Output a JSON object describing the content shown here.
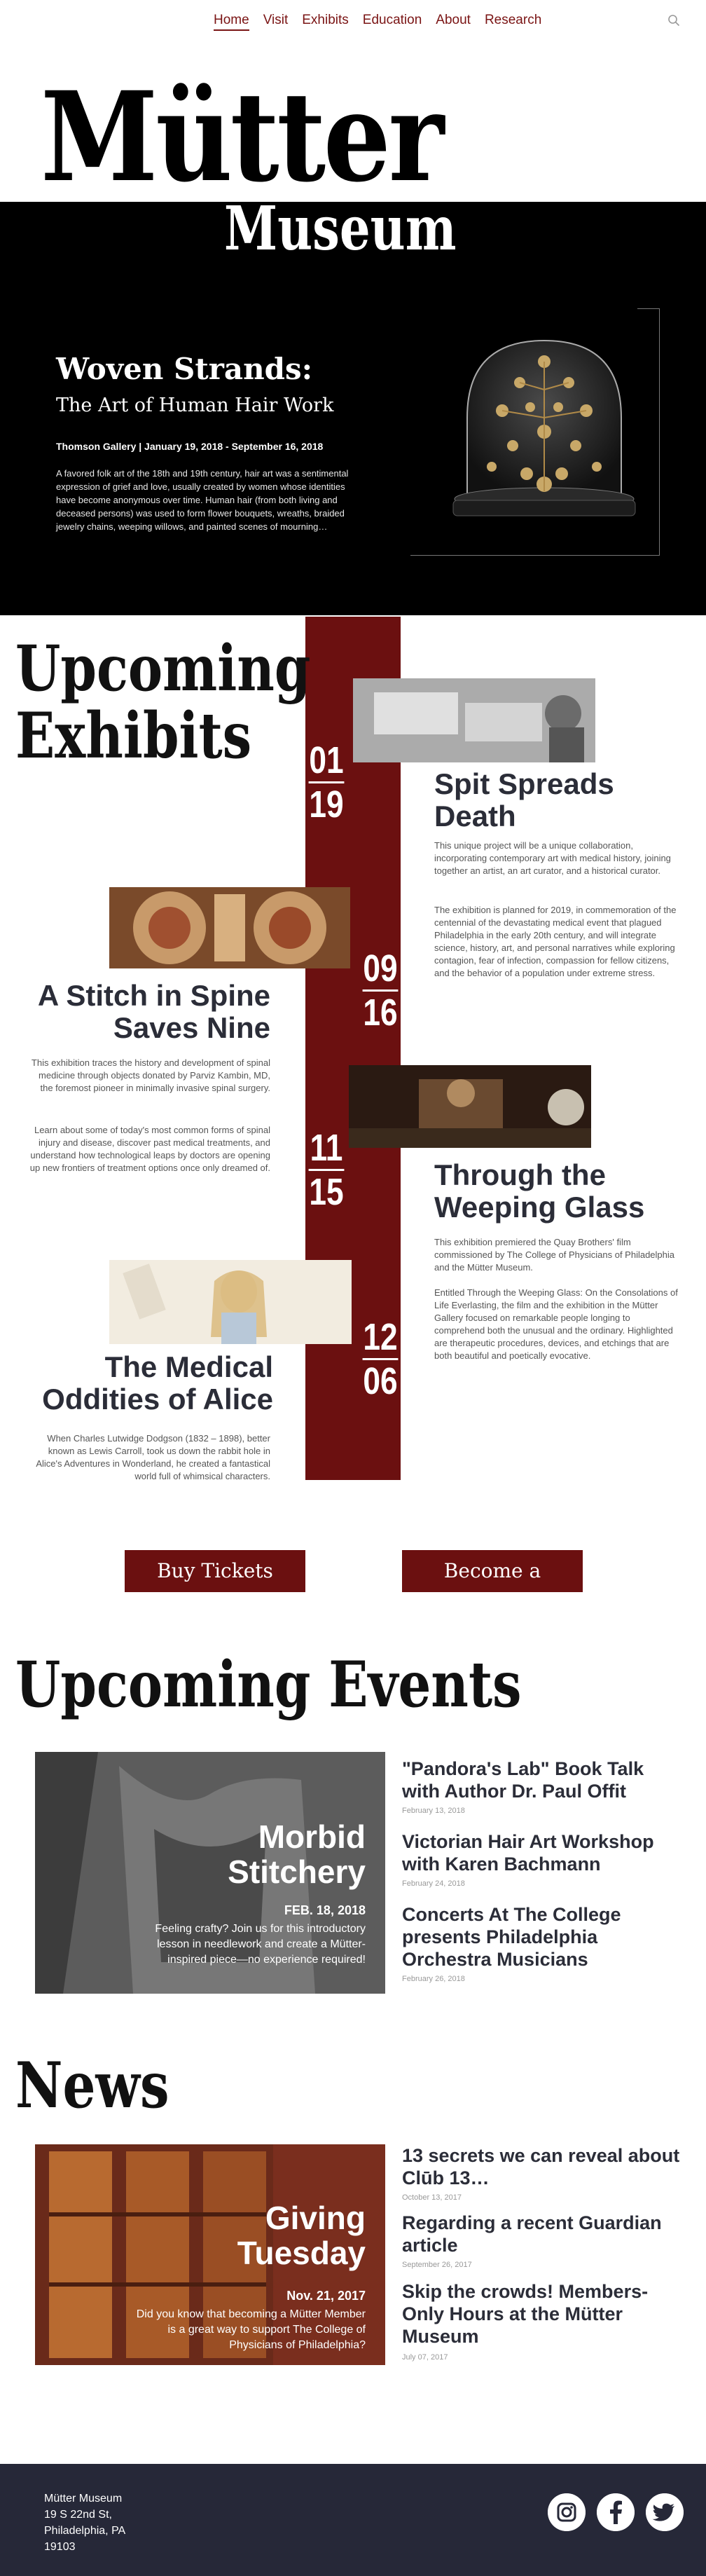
{
  "nav": {
    "items": [
      "Home",
      "Visit",
      "Exhibits",
      "Education",
      "About",
      "Research"
    ],
    "active": "Home"
  },
  "hero": {
    "brand_line1": "Mütter",
    "brand_line2": "Museum",
    "title": "Woven Strands:",
    "subtitle": "The Art of Human Hair Work",
    "gallery_dates": "Thomson Gallery | January 19, 2018 - September 16, 2018",
    "description": "A favored folk art of the 18th and 19th century, hair art was a sentimental expression of grief and love, usually created by women whose identities have become anonymous over time. Human hair (from both living and deceased persons) was used to form flower bouquets, wreaths, braided jewelry chains, weeping willows, and painted scenes of mourning…"
  },
  "exhibits": {
    "heading_line1": "Upcoming",
    "heading_line2": "Exhibits",
    "items": [
      {
        "month": "01",
        "day": "19",
        "title": "Spit Spreads Death",
        "para1": "This unique project will be a unique collaboration, incorporating contemporary art with medical history, joining together an artist, an art curator, and a historical curator.",
        "para2": "The exhibition is planned for 2019, in commemoration of the centennial of the devastating medical event that plagued Philadelphia in the early 20th century, and will integrate science, history, art, and personal narratives while exploring contagion, fear of infection, compassion for fellow citizens, and the behavior of a population under extreme stress."
      },
      {
        "month": "09",
        "day": "16",
        "title": "A Stitch in Spine Saves Nine",
        "para1": "This exhibition traces the history and development of spinal medicine through objects donated by Parviz Kambin, MD, the foremost pioneer in minimally invasive spinal surgery.",
        "para2": "Learn about some of today's most common forms of spinal injury and disease, discover past medical treatments, and understand how technological leaps by doctors are opening up new frontiers of treatment options once only dreamed of."
      },
      {
        "month": "11",
        "day": "15",
        "title": "Through the Weeping Glass",
        "para1": "This exhibition premiered the Quay Brothers' film commissioned by The College of Physicians of Philadelphia and the Mütter Museum.",
        "para2": "Entitled Through the Weeping Glass: On the Consolations of Life Everlasting, the film and the exhibition in the Mütter Gallery focused on remarkable people longing to comprehend both the unusual and the ordinary. Highlighted are therapeutic procedures, devices, and etchings that are both beautiful and poetically evocative."
      },
      {
        "month": "12",
        "day": "06",
        "title": "The Medical Oddities of Alice",
        "para1": "When Charles Lutwidge Dodgson (1832 – 1898), better known as Lewis Carroll, took us down the rabbit hole in Alice's Adventures in Wonderland, he created a fantastical world full of whimsical characters."
      }
    ]
  },
  "buttons": {
    "tickets": "Buy Tickets",
    "member": "Become a Member"
  },
  "events": {
    "heading": "Upcoming Events",
    "featured": {
      "title_line1": "Morbid",
      "title_line2": "Stitchery",
      "date": "FEB. 18, 2018",
      "text": "Feeling crafty? Join us for this introductory lesson in needlework and create a Mütter-inspired piece—no experience required!"
    },
    "list": [
      {
        "title": "\"Pandora's Lab\" Book Talk with Author Dr. Paul Offit",
        "date": "February 13, 2018"
      },
      {
        "title": "Victorian Hair Art Workshop with Karen Bachmann",
        "date": "February 24, 2018"
      },
      {
        "title": "Concerts At The College presents Philadelphia Orchestra Musicians",
        "date": "February 26, 2018"
      }
    ]
  },
  "news": {
    "heading": "News",
    "featured": {
      "title_line1": "Giving",
      "title_line2": "Tuesday",
      "date": "Nov. 21, 2017",
      "text": "Did you know that becoming a Mütter Member is a great way to support The College of Physicians of Philadelphia?"
    },
    "list": [
      {
        "title": "13 secrets we can reveal about Clūb 13…",
        "date": "October 13, 2017"
      },
      {
        "title": "Regarding a recent Guardian article",
        "date": "September 26, 2017"
      },
      {
        "title": "Skip the crowds! Members-Only Hours at the Mütter Museum",
        "date": "July 07, 2017"
      }
    ]
  },
  "footer": {
    "name": "Mütter Museum",
    "street": "19 S 22nd St,",
    "city": "Philadelphia, PA",
    "zip": "19103",
    "social": [
      "instagram-icon",
      "facebook-icon",
      "twitter-icon"
    ]
  },
  "colors": {
    "accent": "#6b1010",
    "text": "#2b2d38",
    "footer": "#262838"
  }
}
